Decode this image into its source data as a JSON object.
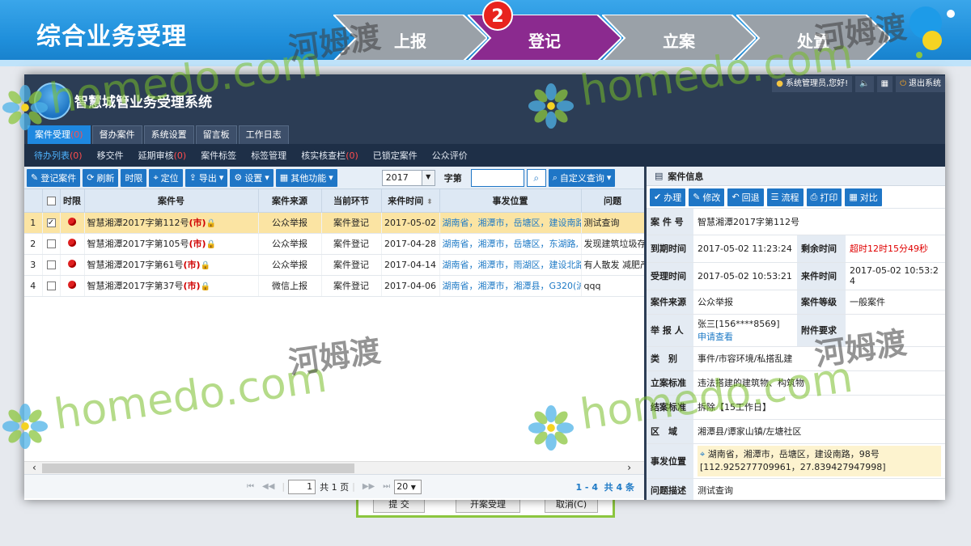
{
  "slide": {
    "title": "综合业务受理",
    "steps": [
      "上报",
      "登记",
      "立案",
      "处置"
    ],
    "active_step_number": "2"
  },
  "app": {
    "title": "智慧城管业务受理系统",
    "user_greeting": "系统管理员,您好!",
    "logout": "退出系统",
    "main_tabs": [
      {
        "label": "案件受理",
        "count": "(0)"
      },
      {
        "label": "督办案件",
        "count": ""
      },
      {
        "label": "系统设置",
        "count": ""
      },
      {
        "label": "留言板",
        "count": ""
      },
      {
        "label": "工作日志",
        "count": ""
      }
    ],
    "sub_nav": [
      {
        "label": "待办列表",
        "count": "(0)"
      },
      {
        "label": "移交件",
        "count": ""
      },
      {
        "label": "延期审核",
        "count": "(0)"
      },
      {
        "label": "案件标签",
        "count": ""
      },
      {
        "label": "标签管理",
        "count": ""
      },
      {
        "label": "核实核查栏",
        "count": "(0)"
      },
      {
        "label": "已锁定案件",
        "count": ""
      },
      {
        "label": "公众评价",
        "count": ""
      }
    ]
  },
  "toolbar": {
    "register": "登记案件",
    "refresh": "刷新",
    "time_limit": "时限",
    "locate": "定位",
    "export": "导出",
    "settings": "设置",
    "other": "其他功能",
    "year": "2017",
    "zi_label": "字第",
    "custom_query": "自定义查询"
  },
  "grid": {
    "headers": [
      "",
      "",
      "时限",
      "案件号",
      "案件来源",
      "当前环节",
      "来件时间",
      "事发位置",
      "问题"
    ],
    "rows": [
      {
        "num": "1",
        "checked": true,
        "case_no": "智慧湘潭2017字第112号",
        "tag": "(市)",
        "source": "公众举报",
        "step": "案件登记",
        "time": "2017-05-02",
        "location": "湖南省，湘潭市，岳塘区，建设南路，9",
        "problem": "测试查询"
      },
      {
        "num": "2",
        "checked": false,
        "case_no": "智慧湘潭2017字第105号",
        "tag": "(市)",
        "source": "公众举报",
        "step": "案件登记",
        "time": "2017-04-28",
        "location": "湖南省，湘潭市，岳塘区，东湖路,",
        "problem": "发现建筑垃圾存在"
      },
      {
        "num": "3",
        "checked": false,
        "case_no": "智慧湘潭2017字第61号",
        "tag": "(市)",
        "source": "公众举报",
        "step": "案件登记",
        "time": "2017-04-14",
        "location": "湖南省，湘潭市，雨湖区，建设北路，3",
        "problem": "有人散发 减肥产品"
      },
      {
        "num": "4",
        "checked": false,
        "case_no": "智慧湘潭2017字第37号",
        "tag": "(市)",
        "source": "微信上报",
        "step": "案件登记",
        "time": "2017-04-06",
        "location": "湖南省，湘潭市，湘潭县，G320(沪瑞",
        "problem": "qqq"
      }
    ]
  },
  "pager": {
    "page": "1",
    "total_pages": "共 1 页",
    "page_size": "20",
    "range": "1 - 4",
    "total": "共 4 条"
  },
  "case_info": {
    "title": "案件信息",
    "actions": [
      "办理",
      "修改",
      "回退",
      "流程",
      "打印",
      "对比"
    ],
    "rows": {
      "case_no_label": "案 件 号",
      "case_no": "智慧湘潭2017字第112号",
      "deadline_label": "到期时间",
      "deadline": "2017-05-02 11:23:24",
      "remain_label": "剩余时间",
      "remain": "超时12时15分49秒",
      "accept_label": "受理时间",
      "accept": "2017-05-02 10:53:21",
      "arrive_label": "来件时间",
      "arrive": "2017-05-02 10:53:24",
      "source_label": "案件来源",
      "source": "公众举报",
      "level_label": "案件等级",
      "level": "一般案件",
      "reporter_label": "举 报 人",
      "reporter": "张三[156****8569]",
      "apply_view": "申请查看",
      "attach_label": "附件要求",
      "category_label": "类　别",
      "category": "事件/市容环境/私搭乱建",
      "standard_label": "立案标准",
      "standard": "违法搭建的建筑物、构筑物",
      "close_label": "结案标准",
      "close": "拆除【15工作日】",
      "area_label": "区　域",
      "area": "湘潭县/谭家山镇/左塘社区",
      "location_label": "事发位置",
      "location": "湖南省，湘潭市，岳塘区，建设南路，98号[112.925277709961，27.839427947998]",
      "desc_label": "问题描述",
      "desc": "测试查询"
    }
  },
  "background": {
    "buttons": [
      "提 交",
      "开案受理",
      "取消(C)"
    ]
  },
  "watermark": {
    "latin": "homedo.com",
    "cn": "河姆渡"
  },
  "colors": {
    "active_step": "#8b2a8f",
    "step": "#9aa1a8",
    "accent": "#1f76c6",
    "header_dark": "#2c3d55",
    "selected_row": "#fbe4a3"
  }
}
